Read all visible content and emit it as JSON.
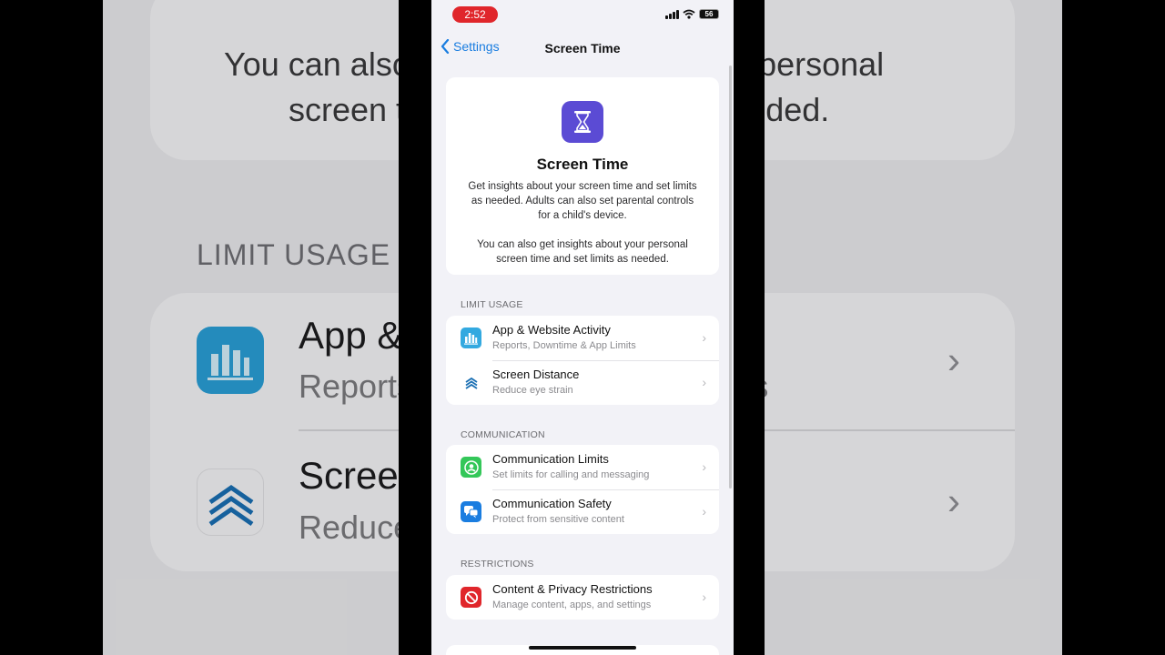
{
  "background": {
    "desc_line1": "You can also get insights about your personal",
    "desc_line2": "screen time and set limits as needed.",
    "section": "LIMIT USAGE",
    "item1_title": "App & Website Activity",
    "item1_sub": "Reports, Downtime & App Limits",
    "item2_title": "Screen Distance",
    "item2_sub": "Reduce eye strain"
  },
  "status_bar": {
    "time": "2:52",
    "battery": "56"
  },
  "nav": {
    "back_label": "Settings",
    "title": "Screen Time"
  },
  "hero": {
    "icon": "hourglass-icon",
    "title": "Screen Time",
    "description": "Get insights about your screen time and set limits as needed. Adults can also set parental controls for a child's device.",
    "description2": "You can also get insights about your personal screen time and set limits as needed."
  },
  "sections": {
    "limit_usage": {
      "label": "LIMIT USAGE",
      "rows": [
        {
          "title": "App & Website Activity",
          "subtitle": "Reports, Downtime & App Limits",
          "icon": "bar-chart-icon",
          "color": "#33a9e0"
        },
        {
          "title": "Screen Distance",
          "subtitle": "Reduce eye strain",
          "icon": "chevrons-up-icon",
          "color": "#1a6fb3"
        }
      ]
    },
    "communication": {
      "label": "COMMUNICATION",
      "rows": [
        {
          "title": "Communication Limits",
          "subtitle": "Set limits for calling and messaging",
          "icon": "person-circle-icon",
          "color": "#34c759"
        },
        {
          "title": "Communication Safety",
          "subtitle": "Protect from sensitive content",
          "icon": "chat-bubbles-icon",
          "color": "#1a7de0"
        }
      ]
    },
    "restrictions": {
      "label": "RESTRICTIONS",
      "rows": [
        {
          "title": "Content & Privacy Restrictions",
          "subtitle": "Manage content, apps, and settings",
          "icon": "no-entry-icon",
          "color": "#e0262b"
        }
      ]
    }
  },
  "colors": {
    "accent": "#1a7de0",
    "hero_icon": "#5b4bd4",
    "time_pill": "#e0262b"
  }
}
